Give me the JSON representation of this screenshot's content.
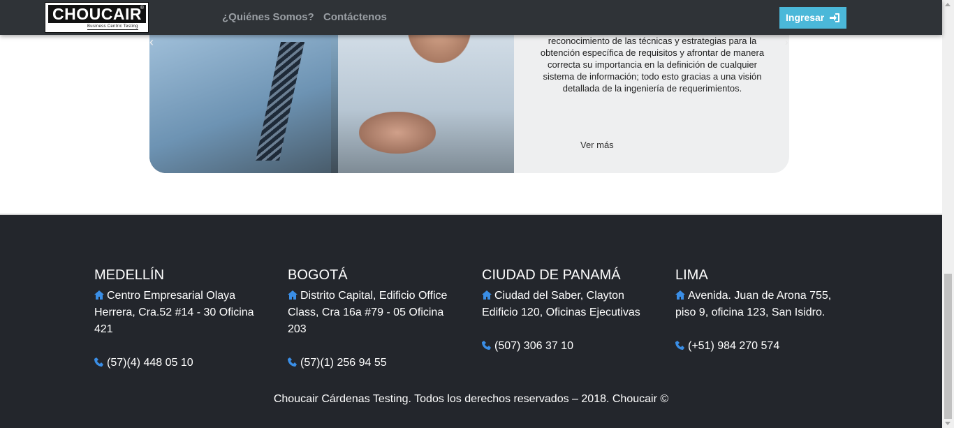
{
  "navbar": {
    "logo_text": "CHOUCAIR",
    "logo_tagline": "Business Centric Testing",
    "links": [
      "¿Quiénes Somos?",
      "Contáctenos"
    ],
    "login_label": "Ingresar",
    "colors": {
      "background": "#2f3337",
      "login": "#4bb8d9",
      "link": "#9a9fa4"
    }
  },
  "card": {
    "text": "reconocimiento de las técnicas y estrategias para la obtención específica de requisitos y afrontar de manera correcta su importancia en la definición de cualquier sistema de información; todo esto gracias a una visión detallada de la ingeniería de requerimientos.",
    "more_label": "Ver más",
    "prev_icon": "chevron-left-icon",
    "next_icon": "chevron-right-icon"
  },
  "footer": {
    "offices": [
      {
        "city": "MEDELLÍN",
        "address": "Centro Empresarial Olaya Herrera, Cra.52 #14 - 30 Oficina 421",
        "phone": "(57)(4) 448 05 10"
      },
      {
        "city": "BOGOTÁ",
        "address": "Distrito Capital, Edificio Office Class, Cra 16a #79 - 05 Oficina 203",
        "phone": "(57)(1) 256 94 55"
      },
      {
        "city": "CIUDAD DE PANAMÁ",
        "address": "Ciudad del Saber, Clayton Edificio 120, Oficinas Ejecutivas",
        "phone": "(507) 306 37 10"
      },
      {
        "city": "LIMA",
        "address": "Avenida. Juan de Arona 755, piso 9, oficina 123, San Isidro.",
        "phone": "(+51) 984 270 574"
      }
    ],
    "copyright": "Choucair Cárdenas Testing. Todos los derechos reservados – 2018. Choucair ©",
    "colors": {
      "background": "#23262c",
      "icon": "#3a8ee6"
    }
  }
}
